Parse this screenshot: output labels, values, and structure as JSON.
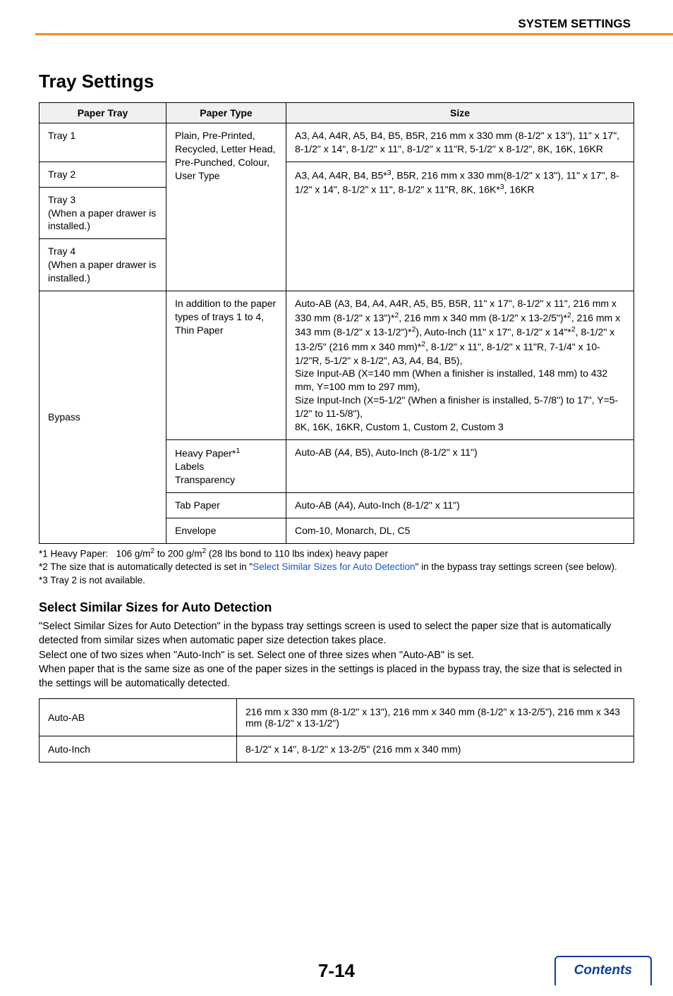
{
  "header": {
    "breadcrumb": "SYSTEM SETTINGS"
  },
  "title": "Tray Settings",
  "table1": {
    "headers": {
      "c1": "Paper Tray",
      "c2": "Paper Type",
      "c3": "Size"
    },
    "rows": {
      "tray1": {
        "label": "Tray 1"
      },
      "tray2": {
        "label": "Tray 2"
      },
      "tray3": {
        "label": "Tray 3\n(When a paper drawer is installed.)"
      },
      "tray4": {
        "label": "Tray 4\n(When a paper drawer is installed.)"
      },
      "type_trays": "Plain, Pre-Printed, Recycled, Letter Head, Pre-Punched, Colour, User Type",
      "size_tray1": "A3, A4, A4R, A5, B4, B5, B5R, 216 mm x 330 mm (8-1/2\" x 13\"), 11\" x 17\", 8-1/2\" x 14\", 8-1/2\" x 11\", 8-1/2\" x 11\"R, 5-1/2\" x 8-1/2\", 8K, 16K, 16KR",
      "size_tray234_pre": "A3, A4, A4R, B4, B5*",
      "size_tray234_post": ", B5R, 216 mm x 330 mm(8-1/2\" x 13\"), 11\" x 17\", 8-1/2\" x 14\", 8-1/2\" x 11\", 8-1/2\" x 11\"R, 8K, 16K*",
      "size_tray234_end": ", 16KR",
      "bypass_label": "Bypass",
      "bypass_type1": "In addition to the paper types of trays 1 to 4, Thin Paper",
      "bypass_size1_html": "Auto-AB (A3, B4, A4, A4R, A5, B5, B5R, 11\" x 17\", 8-1/2\" x 11\", 216 mm x 330 mm (8-1/2\" x 13\")*<sup>2</sup>, 216 mm x 340 mm (8-1/2\" x 13-2/5\")*<sup>2</sup>, 216 mm x 343 mm (8-1/2\" x 13-1/2\")*<sup>2</sup>), Auto-Inch (11\" x 17\", 8-1/2\" x 14\"*<sup>2</sup>, 8-1/2\" x 13-2/5\" (216 mm x 340 mm)*<sup>2</sup>, 8-1/2\" x 11\", 8-1/2\" x 11\"R, 7-1/4\" x 10-1/2\"R, 5-1/2\" x 8-1/2\", A3, A4, B4, B5),<br>Size Input-AB (X=140 mm (When a finisher is installed, 148 mm) to 432 mm, Y=100 mm to 297 mm),<br>Size Input-Inch (X=5-1/2\" (When a finisher is installed, 5-7/8\") to 17\", Y=5-1/2\" to 11-5/8\"),<br>8K, 16K, 16KR, Custom 1, Custom 2, Custom 3",
      "bypass_type2_html": "Heavy Paper*<sup>1</sup><br>Labels<br>Transparency",
      "bypass_size2": "Auto-AB (A4, B5), Auto-Inch (8-1/2\" x 11\")",
      "bypass_type3": "Tab Paper",
      "bypass_size3": "Auto-AB (A4), Auto-Inch (8-1/2\" x 11\")",
      "bypass_type4": "Envelope",
      "bypass_size4": "Com-10, Monarch, DL, C5"
    }
  },
  "footnotes": {
    "f1_html": "*1 Heavy Paper:&nbsp;&nbsp;&nbsp;106 g/m<sup>2</sup> to 200 g/m<sup>2</sup> (28 lbs bond to 110 lbs index) heavy paper",
    "f2_pre": "*2 The size that is automatically detected is set in \"",
    "f2_link": "Select Similar Sizes for Auto Detection",
    "f2_post": "\" in the bypass tray settings screen (see below).",
    "f3": "*3 Tray 2 is not available."
  },
  "subsection": {
    "title": "Select Similar Sizes for Auto Detection",
    "body": "\"Select Similar Sizes for Auto Detection\" in the bypass tray settings screen is used to select the paper size that is automatically detected from similar sizes when automatic paper size detection takes place.\nSelect one of two sizes when \"Auto-Inch\" is set. Select one of three sizes when \"Auto-AB\" is set.\nWhen paper that is the same size as one of the paper sizes in the settings is placed in the bypass tray, the size that is selected in the settings will be automatically detected."
  },
  "table2": {
    "r1": {
      "c1": "Auto-AB",
      "c2": "216 mm x 330 mm (8-1/2\" x 13\"), 216 mm x 340 mm (8-1/2\" x 13-2/5\"), 216 mm x 343 mm (8-1/2\" x 13-1/2\")"
    },
    "r2": {
      "c1": "Auto-Inch",
      "c2": "8-1/2\" x 14\", 8-1/2\" x 13-2/5\" (216 mm x 340 mm)"
    }
  },
  "footer": {
    "page_number": "7-14",
    "contents_label": "Contents"
  }
}
